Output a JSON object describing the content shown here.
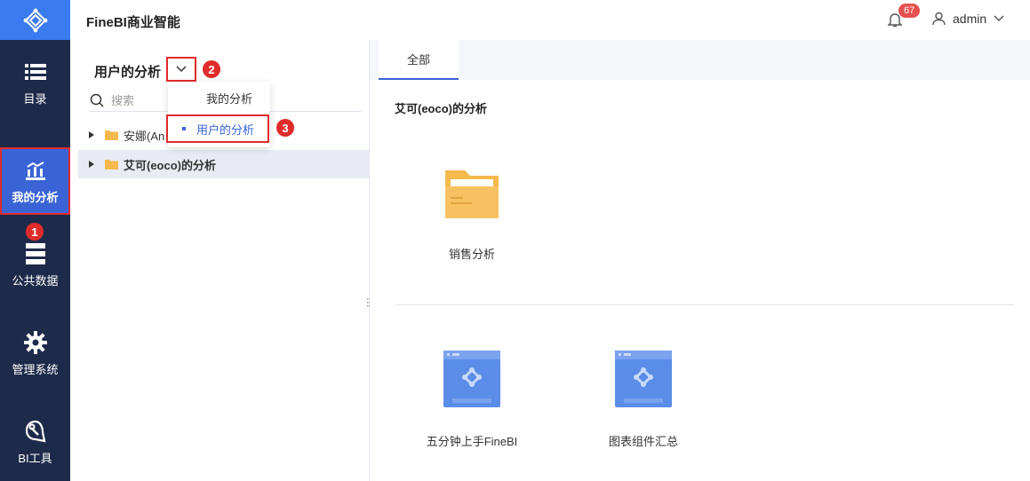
{
  "header": {
    "title": "FineBI商业智能",
    "notification_count": "67",
    "user_name": "admin"
  },
  "nav": {
    "items": [
      {
        "label": "目录",
        "icon": "list-icon"
      },
      {
        "label": "我的分析",
        "icon": "analysis-chart-icon",
        "active": true
      },
      {
        "label": "公共数据",
        "icon": "database-icon"
      },
      {
        "label": "管理系统",
        "icon": "gear-icon"
      },
      {
        "label": "BI工具",
        "icon": "tools-icon"
      }
    ]
  },
  "panel": {
    "title": "用户的分析",
    "search_placeholder": "搜索",
    "tree": [
      {
        "label": "安娜(An"
      },
      {
        "label": "艾可(eoco)的分析",
        "selected": true
      }
    ]
  },
  "dropdown": {
    "items": [
      "我的分析",
      "用户的分析"
    ],
    "selected": "用户的分析"
  },
  "steps": [
    "1",
    "2",
    "3"
  ],
  "main": {
    "tab": "全部",
    "section_title": "艾可(eoco)的分析",
    "folders": [
      {
        "label": "销售分析"
      }
    ],
    "dashboards": [
      {
        "label": "五分钟上手FineBI"
      },
      {
        "label": "图表组件汇总"
      }
    ]
  },
  "colors": {
    "nav_bg": "#1e2a4a",
    "accent": "#3a64d6",
    "highlight": "#e02b2b",
    "folder": "#f6b94d"
  }
}
